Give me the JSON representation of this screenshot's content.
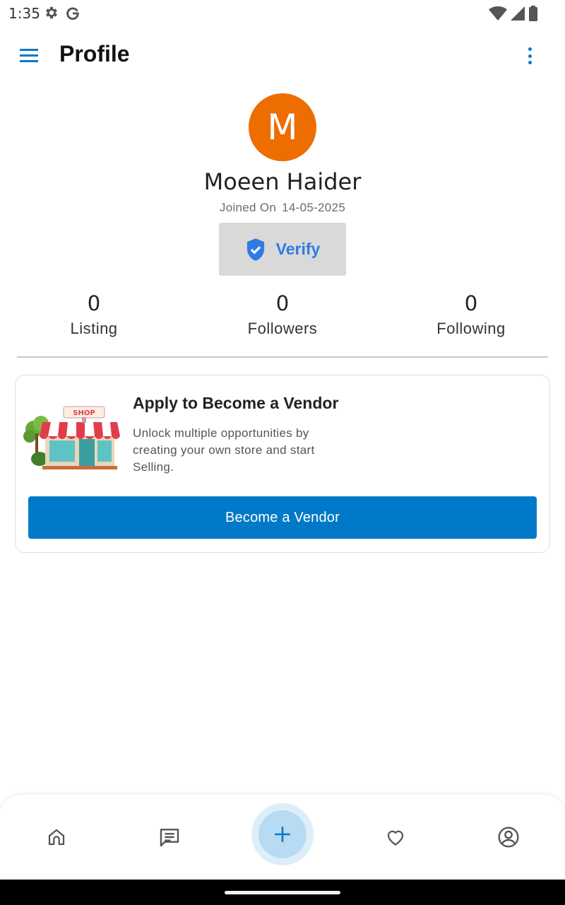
{
  "status_bar": {
    "time": "1:35",
    "left_icons": [
      "settings-icon",
      "google-icon"
    ],
    "right_icons": [
      "wifi-icon",
      "signal-icon",
      "battery-icon"
    ]
  },
  "app_bar": {
    "title": "Profile",
    "menu_icon": "hamburger-menu-icon",
    "overflow_icon": "more-vert-icon"
  },
  "profile": {
    "avatar_initial": "M",
    "avatar_color": "#ee6d00",
    "name": "Moeen Haider",
    "joined_label": "Joined On",
    "joined_date": "14-05-2025",
    "verify_label": "Verify",
    "verify_icon": "shield-check-icon"
  },
  "stats": [
    {
      "value": "0",
      "label": "Listing"
    },
    {
      "value": "0",
      "label": "Followers"
    },
    {
      "value": "0",
      "label": "Following"
    }
  ],
  "vendor_card": {
    "title": "Apply to Become a Vendor",
    "description": "Unlock multiple opportunities by creating your own store and start Selling.",
    "sign_text": "SHOP",
    "button_label": "Become a Vendor",
    "button_color": "#0079c8"
  },
  "bottom_nav": {
    "items": [
      "home-icon",
      "chat-icon",
      "add-icon",
      "heart-icon",
      "account-circle-icon"
    ],
    "active": "account-circle-icon"
  },
  "colors": {
    "accent": "#0a78c8",
    "verify_text": "#2f7be6"
  }
}
